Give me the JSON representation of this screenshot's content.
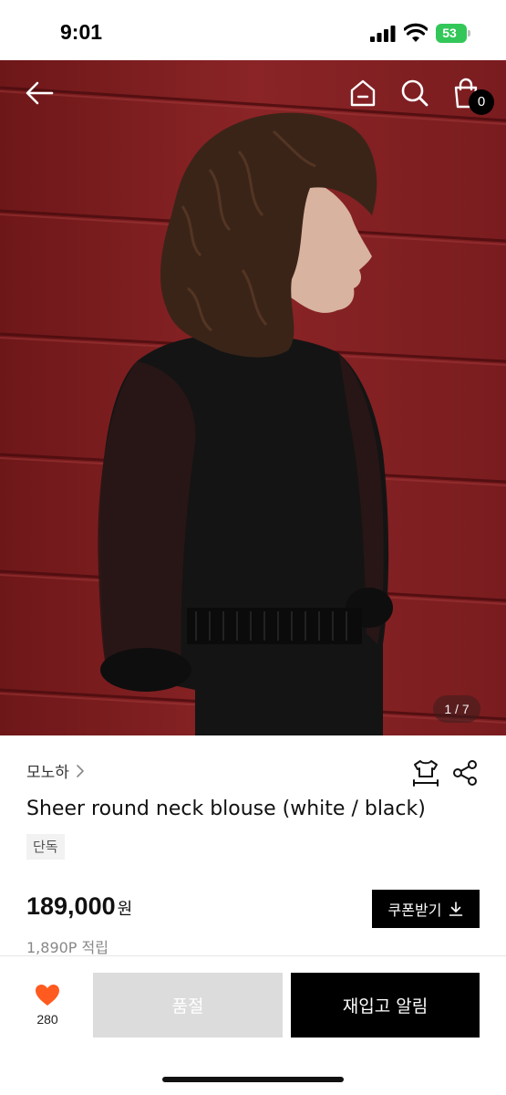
{
  "status_bar": {
    "time": "9:01",
    "battery_level": "53",
    "icons": [
      "signal-icon",
      "wifi-icon",
      "battery-icon"
    ]
  },
  "header": {
    "icons": [
      "back-arrow-icon",
      "home-icon",
      "search-icon",
      "cart-icon"
    ],
    "cart_count": "0"
  },
  "gallery": {
    "counter": "1 / 7"
  },
  "product": {
    "brand": "모노하",
    "title": "Sheer round neck blouse (white / black)",
    "tag": "단독",
    "price": "189,000",
    "price_unit": "원",
    "points": "1,890P 적립",
    "coupon_label": "쿠폰받기",
    "icons": [
      "chevron-right-icon",
      "size-guide-icon",
      "share-icon",
      "download-icon"
    ]
  },
  "bottom_bar": {
    "like_count": "280",
    "soldout_label": "품절",
    "restock_label": "재입고 알림",
    "colors": {
      "heart": "#ff5a1f",
      "soldout_bg": "#dcdcdc",
      "primary": "#000000"
    }
  },
  "colors": {
    "wall": "#7f1e20",
    "battery": "#33c759"
  }
}
